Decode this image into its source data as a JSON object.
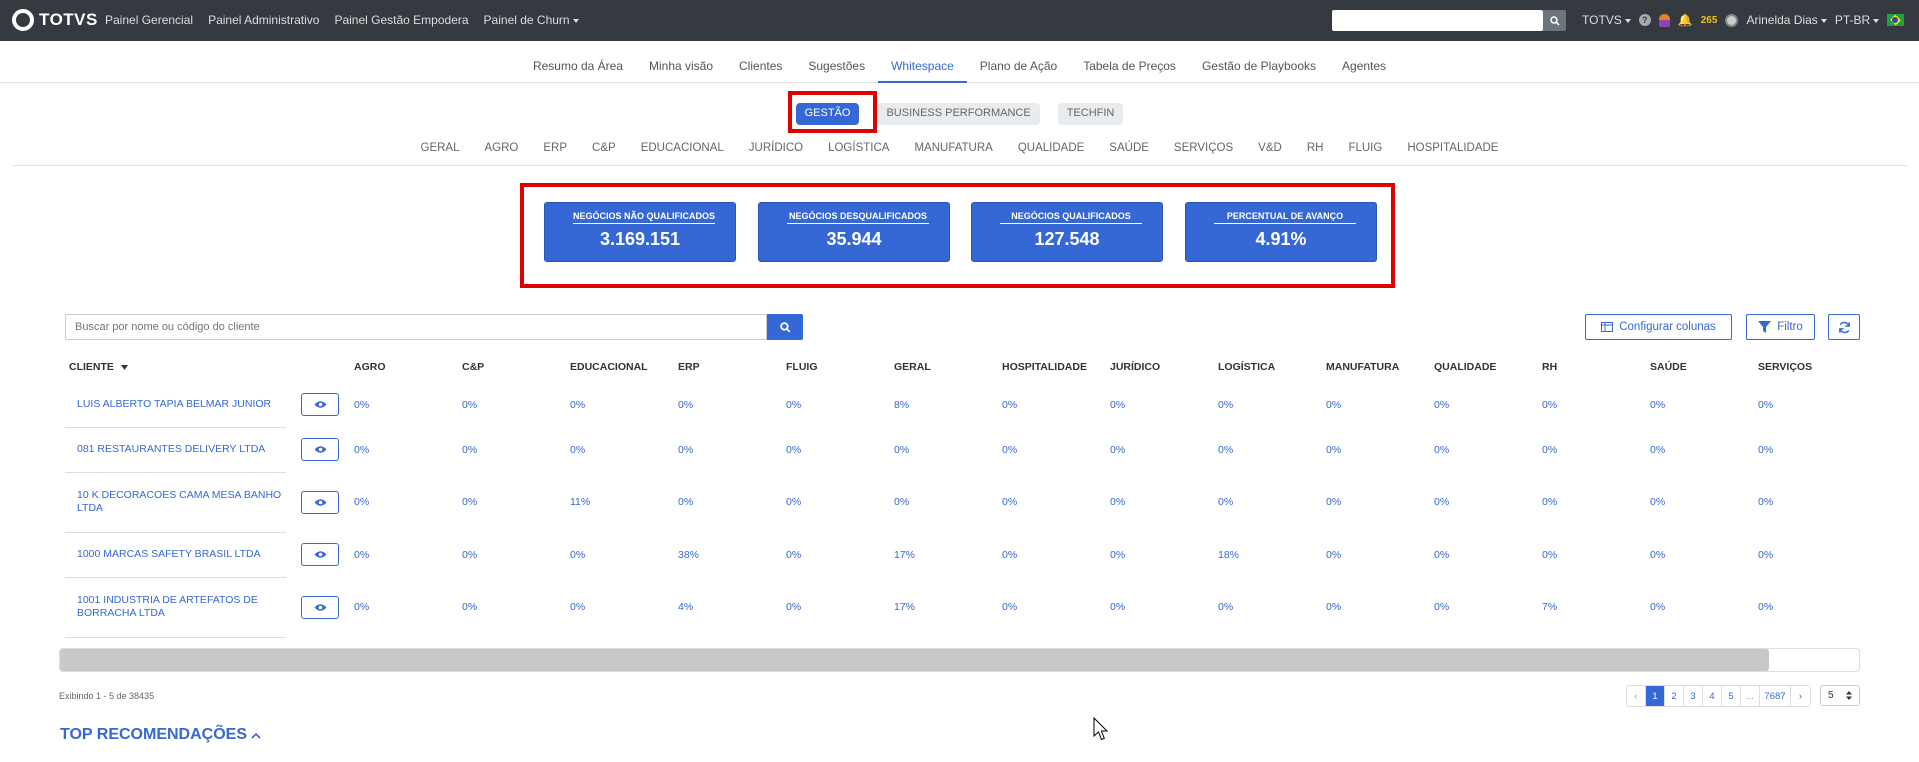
{
  "topbar": {
    "brand": "TOTVS",
    "nav": [
      "Painel Gerencial",
      "Painel Administrativo",
      "Painel Gestão Empodera",
      "Painel de Churn"
    ],
    "company": "TOTVS",
    "notif_count": "265",
    "user": "Arinelda Dias",
    "lang": "PT-BR"
  },
  "subnav": [
    "Resumo da Área",
    "Minha visão",
    "Clientes",
    "Sugestões",
    "Whitespace",
    "Plano de Ação",
    "Tabela de Preços",
    "Gestão de Playbooks",
    "Agentes"
  ],
  "pills": [
    "GESTÃO",
    "BUSINESS PERFORMANCE",
    "TECHFIN"
  ],
  "categories": [
    "GERAL",
    "AGRO",
    "ERP",
    "C&P",
    "EDUCACIONAL",
    "JURÍDICO",
    "LOGÍSTICA",
    "MANUFATURA",
    "QUALIDADE",
    "SAÚDE",
    "SERVIÇOS",
    "V&D",
    "RH",
    "FLUIG",
    "HOSPITALIDADE"
  ],
  "kpis": [
    {
      "label": "NEGÓCIOS NÃO QUALIFICADOS",
      "value": "3.169.151"
    },
    {
      "label": "NEGÓCIOS DESQUALIFICADOS",
      "value": "35.944"
    },
    {
      "label": "NEGÓCIOS QUALIFICADOS",
      "value": "127.548"
    },
    {
      "label": "PERCENTUAL DE AVANÇO",
      "value": "4.91%"
    }
  ],
  "search": {
    "placeholder": "Buscar por nome ou código do cliente"
  },
  "buttons": {
    "config": "Configurar colunas",
    "filter": "Filtro"
  },
  "table": {
    "columns": [
      "CLIENTE",
      "AGRO",
      "C&P",
      "EDUCACIONAL",
      "ERP",
      "FLUIG",
      "GERAL",
      "HOSPITALIDADE",
      "JURÍDICO",
      "LOGÍSTICA",
      "MANUFATURA",
      "QUALIDADE",
      "RH",
      "SAÚDE",
      "SERVIÇOS"
    ],
    "rows": [
      {
        "client": "LUIS ALBERTO TAPIA BELMAR JUNIOR",
        "values": [
          "0%",
          "0%",
          "0%",
          "0%",
          "0%",
          "8%",
          "0%",
          "0%",
          "0%",
          "0%",
          "0%",
          "0%",
          "0%",
          "0%"
        ]
      },
      {
        "client": "081 RESTAURANTES DELIVERY LTDA",
        "values": [
          "0%",
          "0%",
          "0%",
          "0%",
          "0%",
          "0%",
          "0%",
          "0%",
          "0%",
          "0%",
          "0%",
          "0%",
          "0%",
          "0%"
        ]
      },
      {
        "client": "10 K DECORACOES CAMA MESA BANHO LTDA",
        "values": [
          "0%",
          "0%",
          "11%",
          "0%",
          "0%",
          "0%",
          "0%",
          "0%",
          "0%",
          "0%",
          "0%",
          "0%",
          "0%",
          "0%"
        ]
      },
      {
        "client": "1000 MARCAS SAFETY BRASIL LTDA",
        "values": [
          "0%",
          "0%",
          "0%",
          "38%",
          "0%",
          "17%",
          "0%",
          "0%",
          "18%",
          "0%",
          "0%",
          "0%",
          "0%",
          "0%"
        ]
      },
      {
        "client": "1001 INDUSTRIA DE ARTEFATOS DE BORRACHA LTDA",
        "values": [
          "0%",
          "0%",
          "0%",
          "4%",
          "0%",
          "17%",
          "0%",
          "0%",
          "0%",
          "0%",
          "0%",
          "7%",
          "0%",
          "0%"
        ]
      }
    ]
  },
  "pagination": {
    "showing": "Exibindo 1 - 5 de 38435",
    "pages": [
      "‹",
      "1",
      "2",
      "3",
      "4",
      "5",
      "...",
      "7687",
      "›"
    ],
    "page_size": "5"
  },
  "section_title": "TOP RECOMENDAÇÕES",
  "colors": {
    "accent": "#3568d4",
    "topbar": "#343a40",
    "highlight": "#e00000"
  }
}
